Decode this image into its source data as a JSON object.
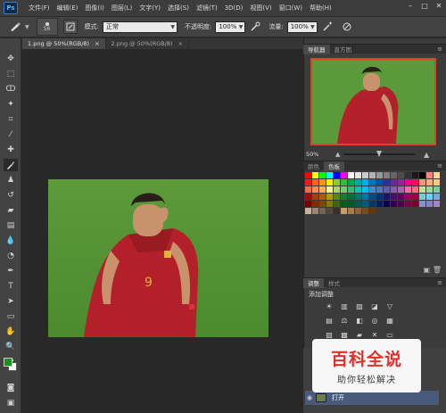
{
  "app": {
    "logo": "Ps"
  },
  "menu": [
    "文件(F)",
    "编辑(E)",
    "图像(I)",
    "图层(L)",
    "文字(Y)",
    "选择(S)",
    "滤镜(T)",
    "3D(D)",
    "视图(V)",
    "窗口(W)",
    "帮助(H)"
  ],
  "window_controls": [
    "–",
    "□",
    "✕"
  ],
  "options": {
    "brush_size": "56",
    "mode_label": "模式:",
    "mode_value": "正常",
    "opacity_label": "不透明度:",
    "opacity_value": "100%",
    "flow_label": "流量:",
    "flow_value": "100%"
  },
  "tabs": [
    {
      "label": "1.png @ 50%(RGB/8)",
      "close": "×"
    },
    {
      "label": "2.png @ 50%(RGB/8)",
      "close": "×"
    }
  ],
  "navigator": {
    "tabs": [
      "导航器",
      "直方图"
    ],
    "zoom": "50%"
  },
  "swatch_panel": {
    "tabs": [
      "颜色",
      "色板"
    ]
  },
  "swatch_colors": [
    "#ff0000",
    "#ffff00",
    "#00ff00",
    "#00ffff",
    "#0000ff",
    "#ff00ff",
    "#ffffff",
    "#e6e6e6",
    "#cccccc",
    "#b3b3b3",
    "#999999",
    "#808080",
    "#666666",
    "#4d4d4d",
    "#333333",
    "#1a1a1a",
    "#000000",
    "#ff8080",
    "#ffd9a0",
    "#ed1c24",
    "#f26522",
    "#f7941d",
    "#fff200",
    "#8dc63f",
    "#39b54a",
    "#00a651",
    "#00a99d",
    "#00aeef",
    "#0072bc",
    "#0054a6",
    "#2e3192",
    "#662d91",
    "#92278f",
    "#ec008c",
    "#ed145b",
    "#f69679",
    "#f9ad81",
    "#fdc689",
    "#f26c4f",
    "#f68e56",
    "#fbaf5d",
    "#fff799",
    "#acd373",
    "#7cc576",
    "#3bb878",
    "#1abbb4",
    "#00bff3",
    "#438cca",
    "#5574b9",
    "#605ca8",
    "#8560a8",
    "#a864a8",
    "#f06eaa",
    "#f26d7d",
    "#c4df9b",
    "#a3d39c",
    "#82ca9c",
    "#9e0b0f",
    "#a0410d",
    "#a36209",
    "#aba000",
    "#598527",
    "#1a7b30",
    "#007236",
    "#00746b",
    "#0076a3",
    "#004b80",
    "#003471",
    "#1b1464",
    "#440e62",
    "#630460",
    "#9e005d",
    "#9e0039",
    "#7accc8",
    "#6dcff6",
    "#7da7d9",
    "#790000",
    "#7b2e00",
    "#7d4900",
    "#827b00",
    "#406618",
    "#005e20",
    "#005826",
    "#005952",
    "#005b7f",
    "#003663",
    "#002157",
    "#0d004c",
    "#32004b",
    "#4b0049",
    "#7b0046",
    "#7a0026",
    "#8393ca",
    "#8781bd",
    "#a187be",
    "#c7b299",
    "#998675",
    "#736357",
    "#534741",
    "#37302a",
    "#c69c6d",
    "#a67c52",
    "#8c6239",
    "#754c24",
    "#603913"
  ],
  "adjustments": {
    "tabs": [
      "调整",
      "样式"
    ],
    "title": "添加调整",
    "row1": [
      "☀",
      "▥",
      "▨",
      "◪",
      "▽"
    ],
    "row2": [
      "▤",
      "⚖",
      "◧",
      "◎",
      "▦"
    ],
    "row3": [
      "▧",
      "▩",
      "▰",
      "✕",
      "▭"
    ]
  },
  "layers": {
    "layer_name": "打开",
    "eye": "◉"
  },
  "watermark": {
    "title": "百科全说",
    "subtitle": "助你轻松解决"
  },
  "colors": {
    "accent": "#e0302a",
    "fg_color": "#1d8f1f",
    "bg_color": "#ffffff"
  },
  "tool_icons": [
    "move-icon",
    "marquee-icon",
    "lasso-icon",
    "magic-wand-icon",
    "crop-icon",
    "eyedropper-icon",
    "healing-icon",
    "brush-icon",
    "stamp-icon",
    "history-brush-icon",
    "eraser-icon",
    "gradient-icon",
    "blur-icon",
    "dodge-icon",
    "pen-icon",
    "type-icon",
    "path-select-icon",
    "shape-icon",
    "hand-icon",
    "zoom-icon"
  ]
}
